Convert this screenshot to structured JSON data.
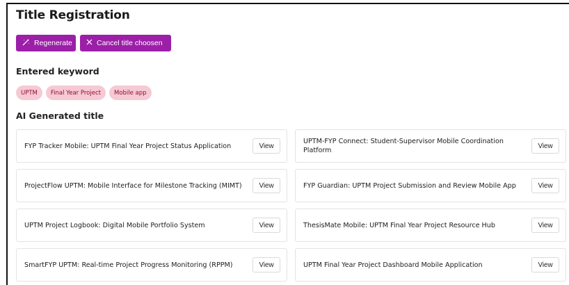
{
  "page": {
    "title": "Title Registration"
  },
  "actions": {
    "regenerate_label": "Regenerate",
    "regenerate_icon": "magic-wand-icon",
    "cancel_label": "Cancel title choosen",
    "cancel_icon": "close-icon"
  },
  "keywords": {
    "heading": "Entered keyword",
    "items": [
      "UPTM",
      "Final Year Project",
      "Mobile app"
    ]
  },
  "ai_titles": {
    "heading": "AI Generated title",
    "view_label": "View",
    "items": [
      {
        "title": "FYP Tracker Mobile: UPTM Final Year Project Status Application"
      },
      {
        "title": "UPTM-FYP Connect: Student-Supervisor Mobile Coordination Platform"
      },
      {
        "title": "ProjectFlow UPTM: Mobile Interface for Milestone Tracking (MIMT)"
      },
      {
        "title": "FYP Guardian: UPTM Project Submission and Review Mobile App"
      },
      {
        "title": "UPTM Project Logbook: Digital Mobile Portfolio System"
      },
      {
        "title": "ThesisMate Mobile: UPTM Final Year Project Resource Hub"
      },
      {
        "title": "SmartFYP UPTM: Real-time Project Progress Monitoring (RPPM)"
      },
      {
        "title": "UPTM Final Year Project Dashboard Mobile Application"
      }
    ]
  },
  "colors": {
    "primary_button": "#9c1fa8",
    "chip_bg": "#f6c9d4",
    "chip_text": "#8a1030"
  }
}
